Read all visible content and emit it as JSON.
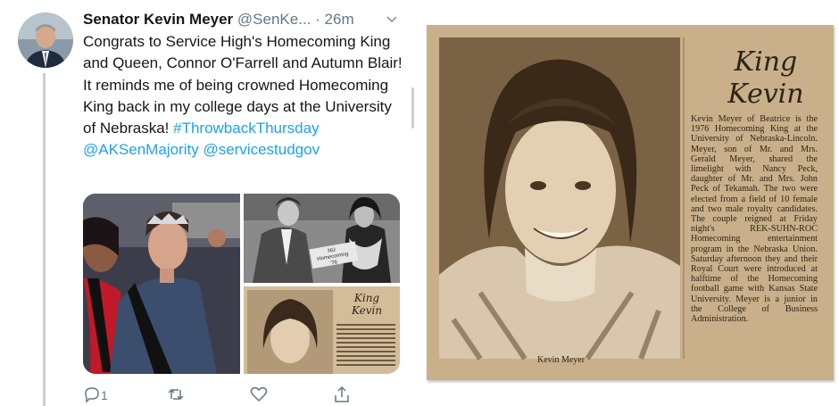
{
  "tweet": {
    "author_name": "Senator Kevin Meyer",
    "author_handle": "@SenKe...",
    "separator": "·",
    "time": "26m",
    "text_parts": {
      "p1": "Congrats to Service High's Homecoming King and Queen, Connor O'Farrell and Autumn Blair! It reminds me of being crowned Homecoming King back in my college days at the University of Nebraska! ",
      "hashtag": "#ThrowbackThursday",
      "mention1": "@AKSenMajority",
      "mention2": "@servicestudgov"
    },
    "actions": {
      "reply_count": "1",
      "retweet_count": "",
      "like_count": ""
    },
    "icons": [
      "chevron-down-icon",
      "reply-icon",
      "retweet-icon",
      "like-icon",
      "share-icon"
    ],
    "media_thumb": {
      "title_line1": "King",
      "title_line2": "Kevin",
      "sign": "NU Homecoming '76"
    }
  },
  "clipping": {
    "title_line1": "King",
    "title_line2": "Kevin",
    "article": "Kevin Meyer of Beatrice is the 1976 Homecoming King at the University of Nebraska-Lincoln. Meyer, son of Mr. and Mrs. Gerald Meyer, shared the limelight with Nancy Peck, daughter of Mr. and Mrs. John Peck of Tekamah. The two were elected from a field of 10 female and two male royalty candidates. The couple reigned at Friday night's REK-SUHN-ROC Homecoming entertainment program in the Nebraska Union. Saturday afternoon they and their Royal Court were introduced at halftime of the Homecoming football game with Kansas State University. Meyer is a junior in the College of Business Administration.",
    "caption": "Kevin Meyer"
  },
  "colors": {
    "link": "#1da1f2",
    "text": "#14171a",
    "muted": "#657786",
    "newsprint": "#c9b08a"
  }
}
